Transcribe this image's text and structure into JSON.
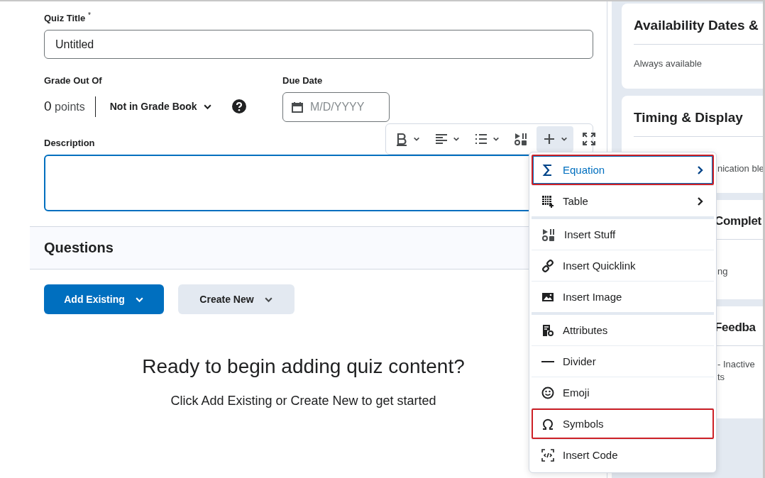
{
  "form": {
    "title_label": "Quiz Title",
    "required_mark": "*",
    "title_value": "Untitled",
    "grade_label": "Grade Out Of",
    "points_value": "0",
    "points_unit": "points",
    "grade_book": "Not in Grade Book",
    "due_label": "Due Date",
    "due_placeholder": "M/D/YYYY",
    "description_label": "Description"
  },
  "toolbar": [
    {
      "kind": "bold",
      "active": false
    },
    {
      "kind": "align",
      "active": false
    },
    {
      "kind": "list",
      "active": false
    },
    {
      "kind": "stuff",
      "active": false
    },
    {
      "kind": "insert",
      "active": true
    },
    {
      "kind": "fullscreen",
      "active": false
    }
  ],
  "insert_menu": [
    {
      "items": [
        {
          "kind": "equation",
          "label": "Equation",
          "submenu": true,
          "selected": true,
          "highlighted": true
        },
        {
          "kind": "table",
          "label": "Table",
          "submenu": true,
          "selected": false,
          "highlighted": false
        }
      ]
    },
    {
      "items": [
        {
          "kind": "stuff",
          "label": "Insert Stuff",
          "submenu": false,
          "selected": false,
          "highlighted": false
        },
        {
          "kind": "quicklink",
          "label": "Insert Quicklink",
          "submenu": false,
          "selected": false,
          "highlighted": false
        },
        {
          "kind": "image",
          "label": "Insert Image",
          "submenu": false,
          "selected": false,
          "highlighted": false
        }
      ]
    },
    {
      "items": [
        {
          "kind": "attributes",
          "label": "Attributes",
          "submenu": false,
          "selected": false,
          "highlighted": false
        },
        {
          "kind": "divider",
          "label": "Divider",
          "submenu": false,
          "selected": false,
          "highlighted": false
        },
        {
          "kind": "emoji",
          "label": "Emoji",
          "submenu": false,
          "selected": false,
          "highlighted": false
        },
        {
          "kind": "symbols",
          "label": "Symbols",
          "submenu": false,
          "selected": false,
          "highlighted": true
        },
        {
          "kind": "code",
          "label": "Insert Code",
          "submenu": false,
          "selected": false,
          "highlighted": false
        }
      ]
    }
  ],
  "questions": {
    "title": "Questions",
    "buttons": [
      {
        "kind": "primary",
        "label": "Add Existing"
      },
      {
        "kind": "secondary",
        "label": "Create New"
      }
    ],
    "empty_title": "Ready to begin adding quiz content?",
    "empty_text": "Click Add Existing or Create New to get started"
  },
  "sidebar": [
    {
      "title": {
        "text": "Availability Dates &",
        "covered": false
      },
      "body": [
        {
          "text": "Always available",
          "covered": false
        }
      ]
    },
    {
      "title": {
        "text": "Timing & Display",
        "covered": false
      },
      "body": [
        {
          "text": "nication ble",
          "covered": true
        }
      ]
    },
    {
      "title": {
        "text": "Complet",
        "covered": true
      },
      "body": [
        {
          "text": "ng",
          "covered": true
        }
      ]
    },
    {
      "title": {
        "text": "Feedba",
        "covered": true
      },
      "body": [
        {
          "text": "- Inactive",
          "covered": true
        },
        {
          "text": "ts",
          "covered": true
        }
      ]
    }
  ]
}
